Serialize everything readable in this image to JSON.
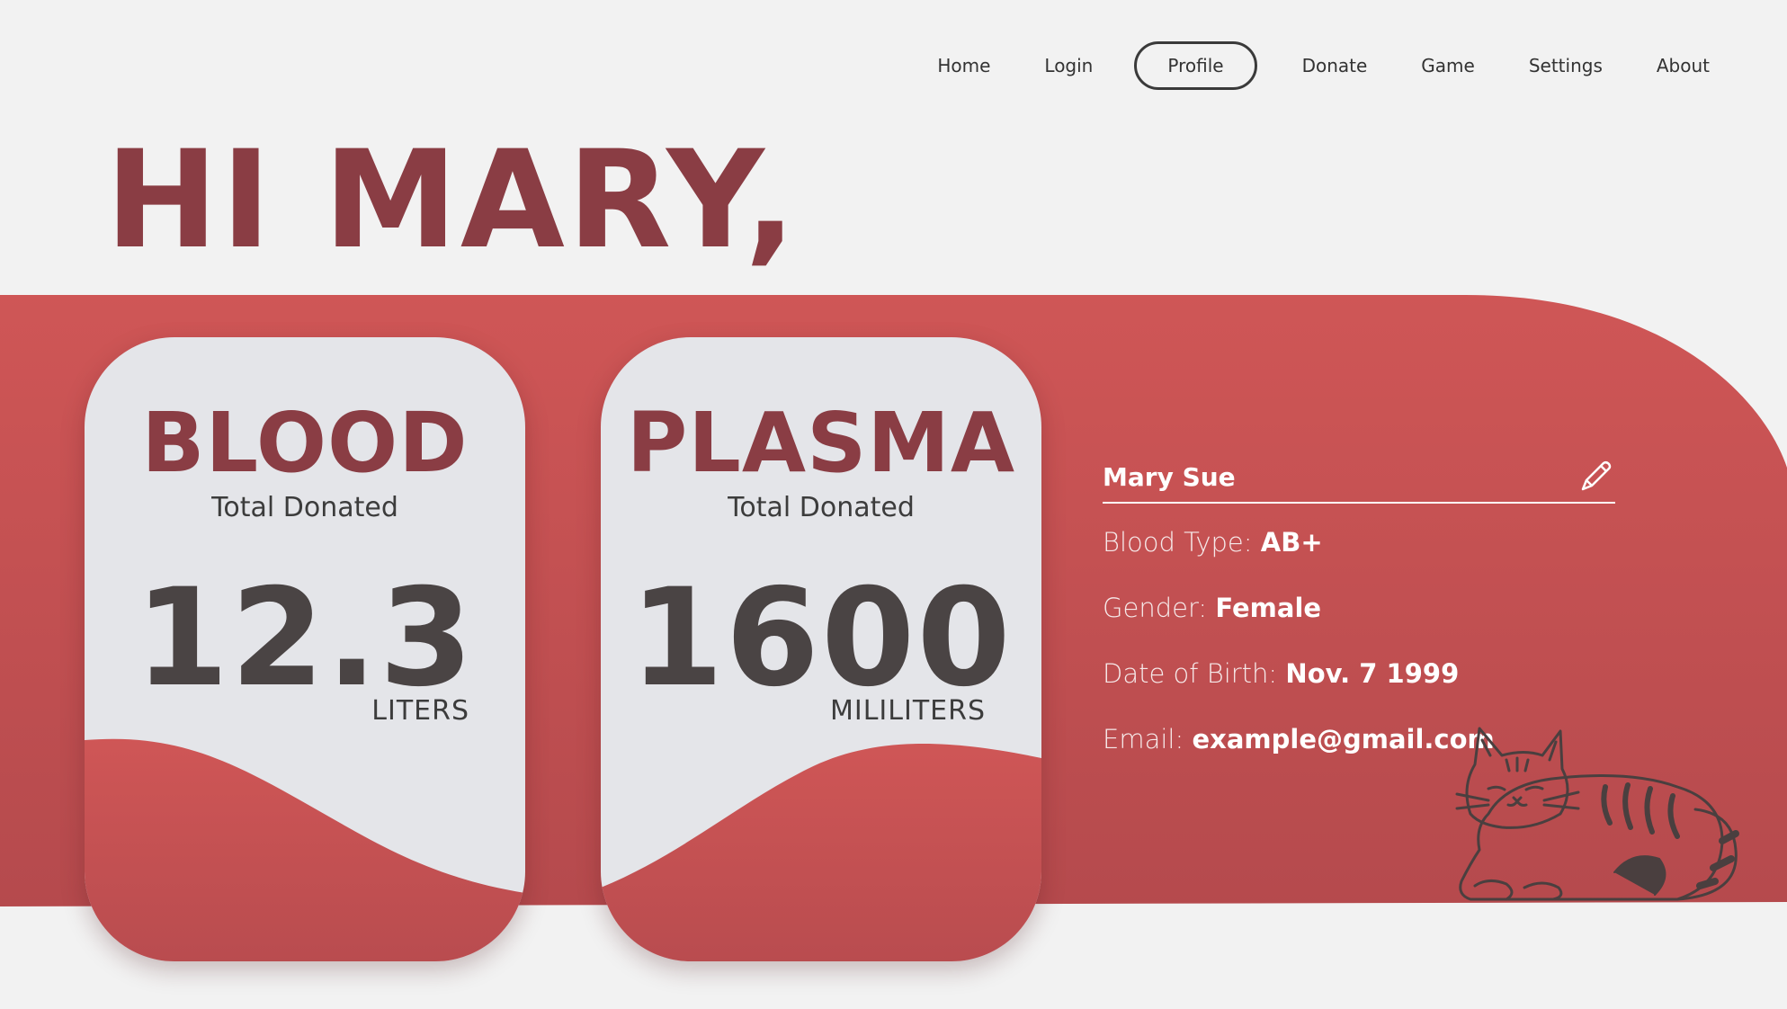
{
  "nav": {
    "items": [
      {
        "label": "Home",
        "active": false
      },
      {
        "label": "Login",
        "active": false
      },
      {
        "label": "Profile",
        "active": true
      },
      {
        "label": "Donate",
        "active": false
      },
      {
        "label": "Game",
        "active": false
      },
      {
        "label": "Settings",
        "active": false
      },
      {
        "label": "About",
        "active": false
      }
    ]
  },
  "greeting": "HI MARY,",
  "cards": [
    {
      "title": "BLOOD",
      "subtitle": "Total Donated",
      "value": "12.3",
      "unit": "LITERS"
    },
    {
      "title": "PLASMA",
      "subtitle": "Total Donated",
      "value": "1600",
      "unit": "MILILITERS"
    }
  ],
  "profile": {
    "name": "Mary Sue",
    "edit_icon": "pencil-icon",
    "fields": [
      {
        "label": "Blood Type:",
        "value": "AB+"
      },
      {
        "label": "Gender:",
        "value": "Female"
      },
      {
        "label": "Date of Birth:",
        "value": "Nov. 7 1999"
      },
      {
        "label": "Email:",
        "value": "example@gmail.com"
      }
    ]
  },
  "illustration": "cat-illustration",
  "colors": {
    "background": "#f2f2f2",
    "band": "#cd5555",
    "accent_text": "#8a3d44",
    "card": "#e4e5e9",
    "value_text": "#4a4444"
  }
}
